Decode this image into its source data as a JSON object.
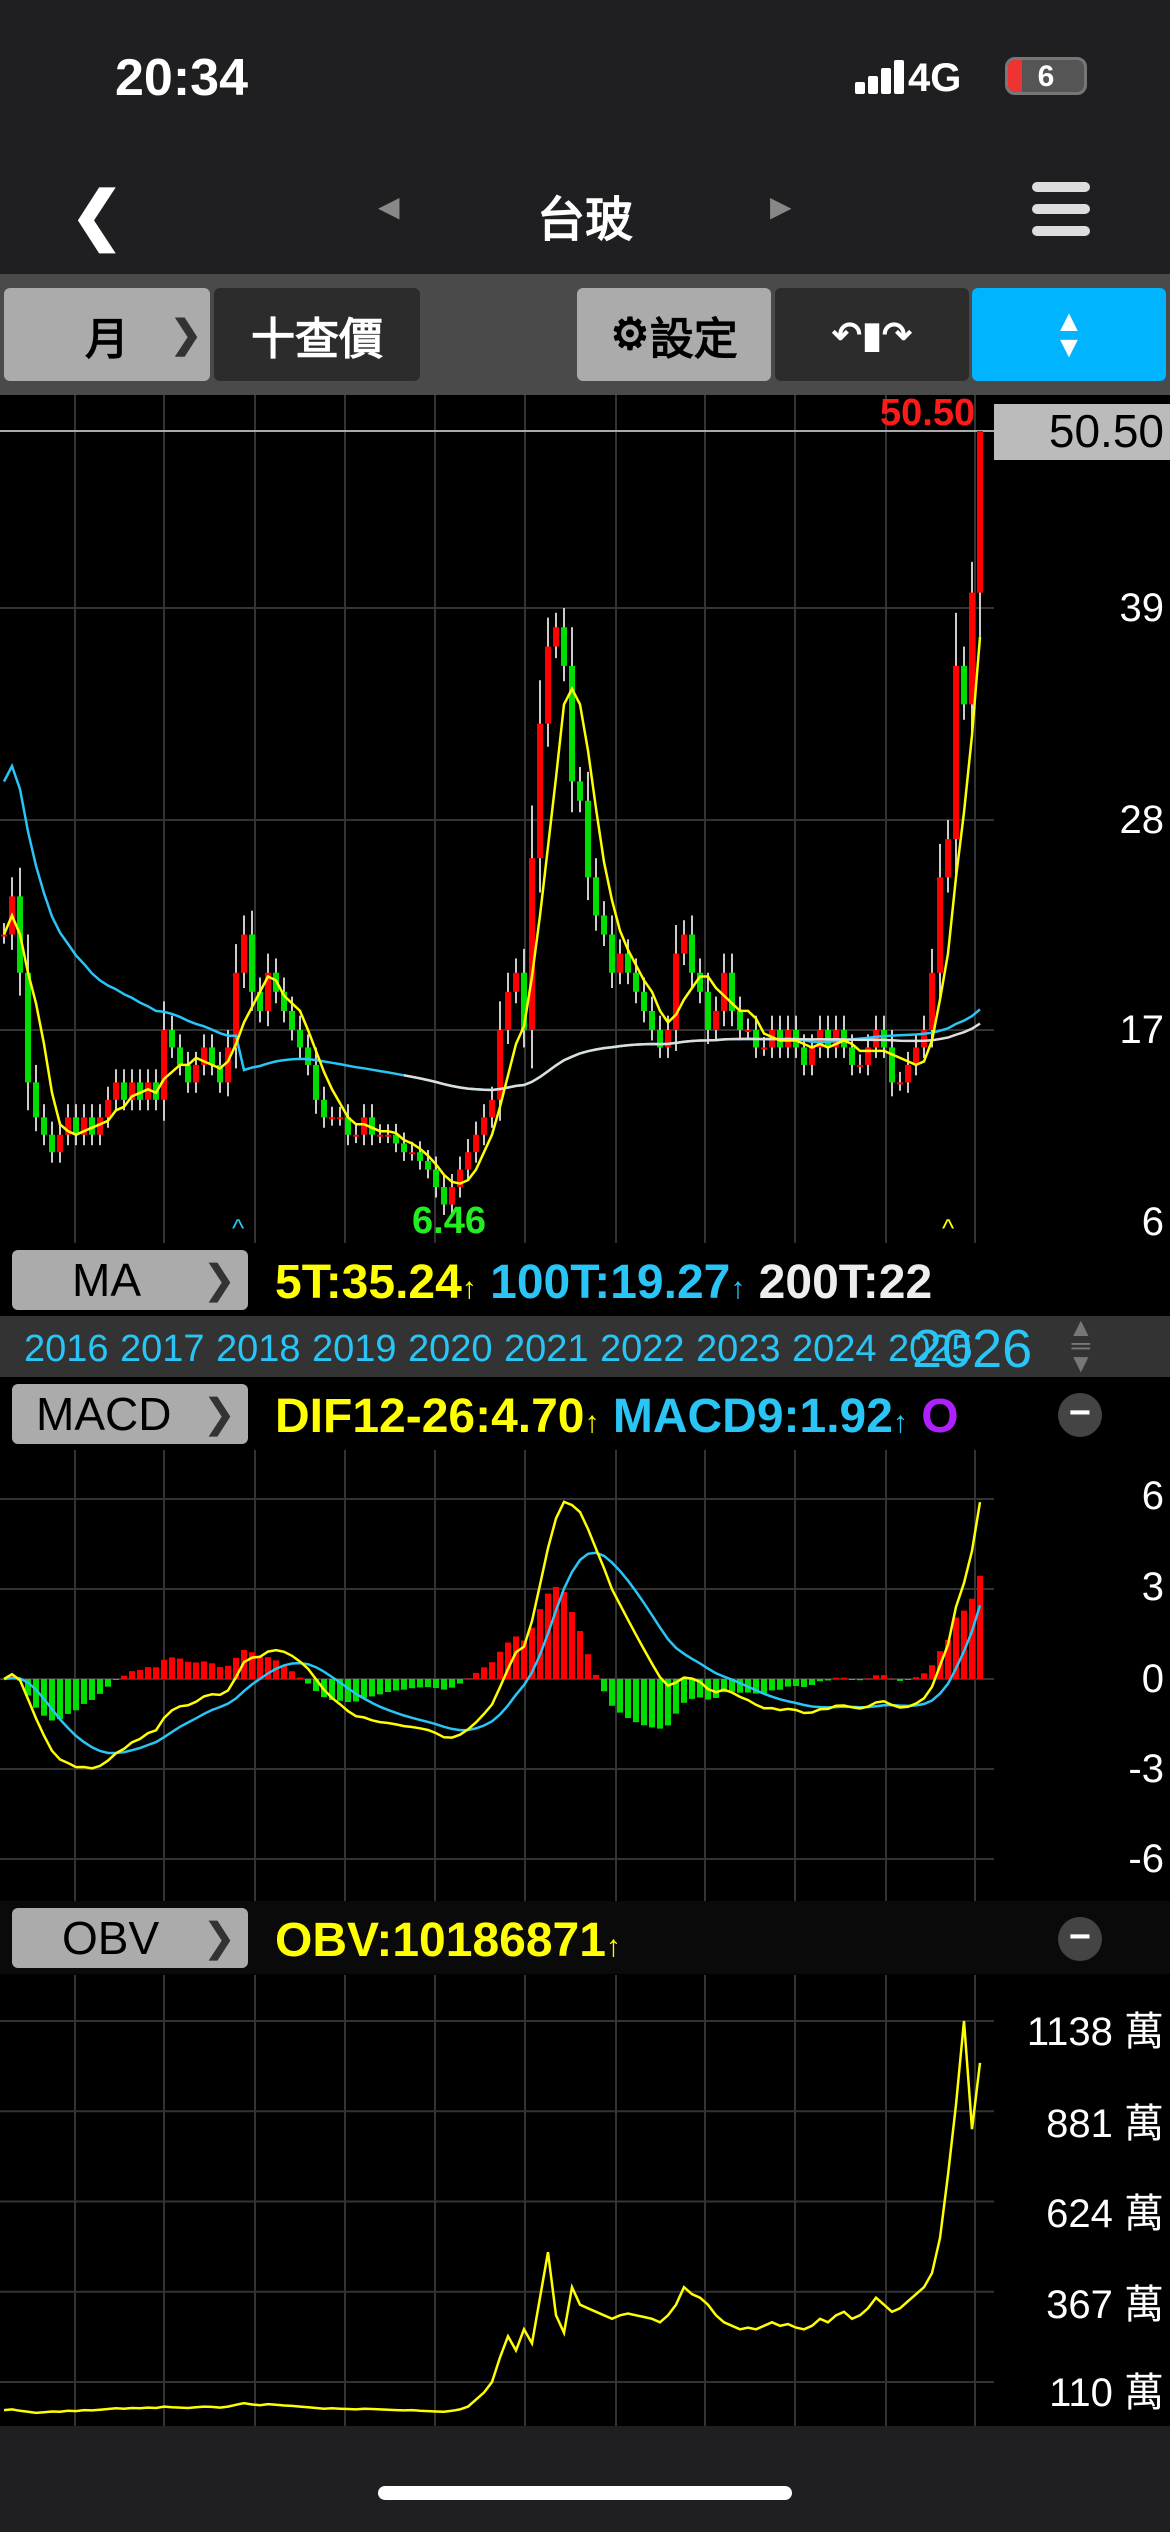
{
  "status": {
    "time": "20:34",
    "network": "4G",
    "battery": "6"
  },
  "nav": {
    "title": "台玻",
    "back_icon": "chevron-left",
    "menu_icon": "hamburger"
  },
  "toolbar": {
    "period": "月",
    "quote": "十查價",
    "settings": "設定",
    "rotate_icon": "rotate",
    "fullscreen_icon": "collapse"
  },
  "main_chart": {
    "last_price_label": "50.50",
    "high_label": "50.50",
    "low_label": "6.46",
    "price_ticks": [
      "50.50",
      "39",
      "28",
      "17",
      "6"
    ]
  },
  "ma_row": {
    "button": "MA",
    "ma5": "5T:35.24",
    "ma100": "100T:19.27",
    "ma200": "200T:22"
  },
  "years": [
    "2016",
    "2017",
    "2018",
    "2019",
    "2020",
    "2021",
    "2022",
    "2023",
    "2024",
    "2025",
    "2026"
  ],
  "macd_row": {
    "button": "MACD",
    "dif": "DIF12-26:4.70",
    "macd": "MACD9:1.92",
    "osc": "O",
    "ticks": [
      "6",
      "3",
      "0",
      "-3",
      "-6"
    ]
  },
  "obv_row": {
    "button": "OBV",
    "obv": "OBV:10186871",
    "ticks": [
      "1138 萬",
      "881 萬",
      "624 萬",
      "367 萬",
      "110 萬"
    ]
  },
  "colors": {
    "up": "#ff0000",
    "down": "#00e000",
    "ma5": "#ffff00",
    "ma100": "#29c5f6",
    "ma200": "#dddddd",
    "accent": "#00b4ff"
  },
  "chart_data": {
    "type": "candlestick",
    "period": "monthly",
    "start": "2016-01",
    "close": [
      22,
      24,
      20,
      14,
      12,
      11,
      10,
      11,
      12,
      11,
      12,
      11,
      12,
      13,
      14,
      13,
      14,
      13,
      14,
      13,
      17,
      16,
      15,
      14,
      15,
      16,
      15,
      14,
      16,
      20,
      22,
      19,
      18,
      20,
      19,
      18,
      17,
      16,
      15,
      13,
      12,
      12,
      12,
      11,
      11,
      12,
      11,
      11,
      11,
      10.5,
      10,
      10,
      9.5,
      9,
      8,
      7,
      8,
      9,
      10,
      11,
      12,
      13,
      17,
      19,
      20,
      17,
      26,
      33,
      37,
      38,
      36,
      30,
      29,
      25,
      23,
      22,
      20,
      21,
      20,
      19,
      18,
      17,
      16,
      17,
      21,
      22,
      20,
      19,
      17,
      18,
      20,
      18,
      17,
      17,
      16,
      16,
      17,
      16,
      17,
      16,
      15,
      16,
      17,
      16,
      17,
      16,
      15,
      15,
      16,
      17,
      16,
      14,
      14,
      15,
      16,
      17,
      20,
      25,
      27,
      36,
      34,
      40,
      50.5
    ],
    "obv_wan": [
      30,
      32,
      28,
      25,
      22,
      24,
      26,
      25,
      28,
      27,
      30,
      29,
      31,
      33,
      35,
      34,
      36,
      35,
      37,
      36,
      40,
      38,
      37,
      36,
      38,
      40,
      39,
      37,
      40,
      45,
      50,
      46,
      44,
      47,
      45,
      43,
      42,
      40,
      38,
      36,
      34,
      35,
      34,
      33,
      32,
      34,
      33,
      32,
      31,
      30,
      29,
      30,
      28,
      27,
      26,
      25,
      28,
      32,
      40,
      60,
      80,
      110,
      180,
      240,
      200,
      260,
      220,
      350,
      480,
      300,
      250,
      380,
      330,
      320,
      310,
      300,
      290,
      300,
      305,
      300,
      295,
      290,
      280,
      300,
      330,
      380,
      360,
      350,
      330,
      300,
      280,
      270,
      260,
      265,
      260,
      270,
      280,
      270,
      275,
      265,
      260,
      270,
      290,
      280,
      300,
      310,
      290,
      300,
      320,
      350,
      330,
      310,
      320,
      340,
      360,
      380,
      420,
      520,
      700,
      900,
      1138,
      830,
      1018.6871
    ],
    "price_axis": [
      6,
      17,
      28,
      39,
      50.5
    ],
    "macd_axis": [
      -6,
      6
    ],
    "obv_axis_wan": [
      110,
      1138
    ]
  }
}
